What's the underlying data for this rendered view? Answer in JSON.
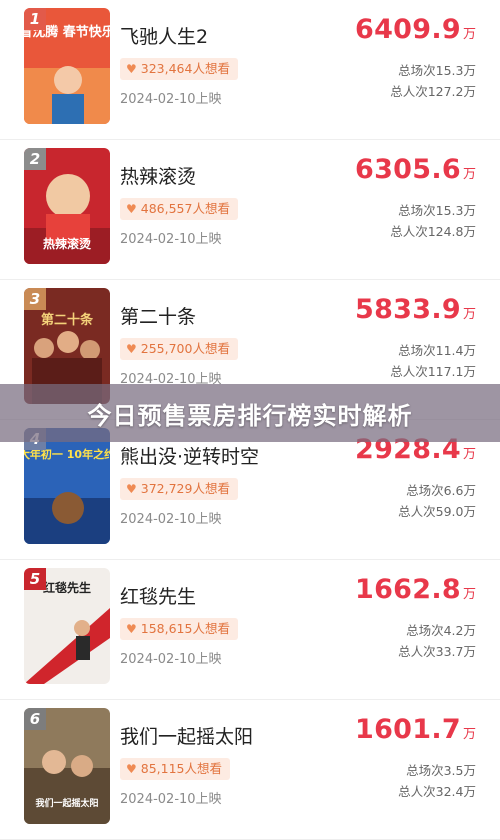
{
  "banner_title": "今日预售票房排行榜实时解析",
  "colors": {
    "gross": "#e8384a",
    "badge_bg": "#fdebe2",
    "badge_text": "#e2743f"
  },
  "movies": [
    {
      "rank": "1",
      "title": "飞驰人生2",
      "wish": "323,464人想看",
      "date": "2024-02-10上映",
      "gross": "6409.9",
      "unit": "万",
      "screenings": "总场次15.3万",
      "viewers": "总人次127.2万",
      "poster_text": "看沈腾 春节快乐"
    },
    {
      "rank": "2",
      "title": "热辣滚烫",
      "wish": "486,557人想看",
      "date": "2024-02-10上映",
      "gross": "6305.6",
      "unit": "万",
      "screenings": "总场次15.3万",
      "viewers": "总人次124.8万",
      "poster_text": "热辣滚烫"
    },
    {
      "rank": "3",
      "title": "第二十条",
      "wish": "255,700人想看",
      "date": "2024-02-10上映",
      "gross": "5833.9",
      "unit": "万",
      "screenings": "总场次11.4万",
      "viewers": "总人次117.1万",
      "poster_text": "第二十条"
    },
    {
      "rank": "4",
      "title": "熊出没·逆转时空",
      "wish": "372,729人想看",
      "date": "2024-02-10上映",
      "gross": "2928.4",
      "unit": "万",
      "screenings": "总场次6.6万",
      "viewers": "总人次59.0万",
      "poster_text": "大年初一 10年之约"
    },
    {
      "rank": "5",
      "title": "红毯先生",
      "wish": "158,615人想看",
      "date": "2024-02-10上映",
      "gross": "1662.8",
      "unit": "万",
      "screenings": "总场次4.2万",
      "viewers": "总人次33.7万",
      "poster_text": "红毯先生"
    },
    {
      "rank": "6",
      "title": "我们一起摇太阳",
      "wish": "85,115人想看",
      "date": "2024-02-10上映",
      "gross": "1601.7",
      "unit": "万",
      "screenings": "总场次3.5万",
      "viewers": "总人次32.4万",
      "poster_text": "我们一起摇太阳"
    }
  ]
}
